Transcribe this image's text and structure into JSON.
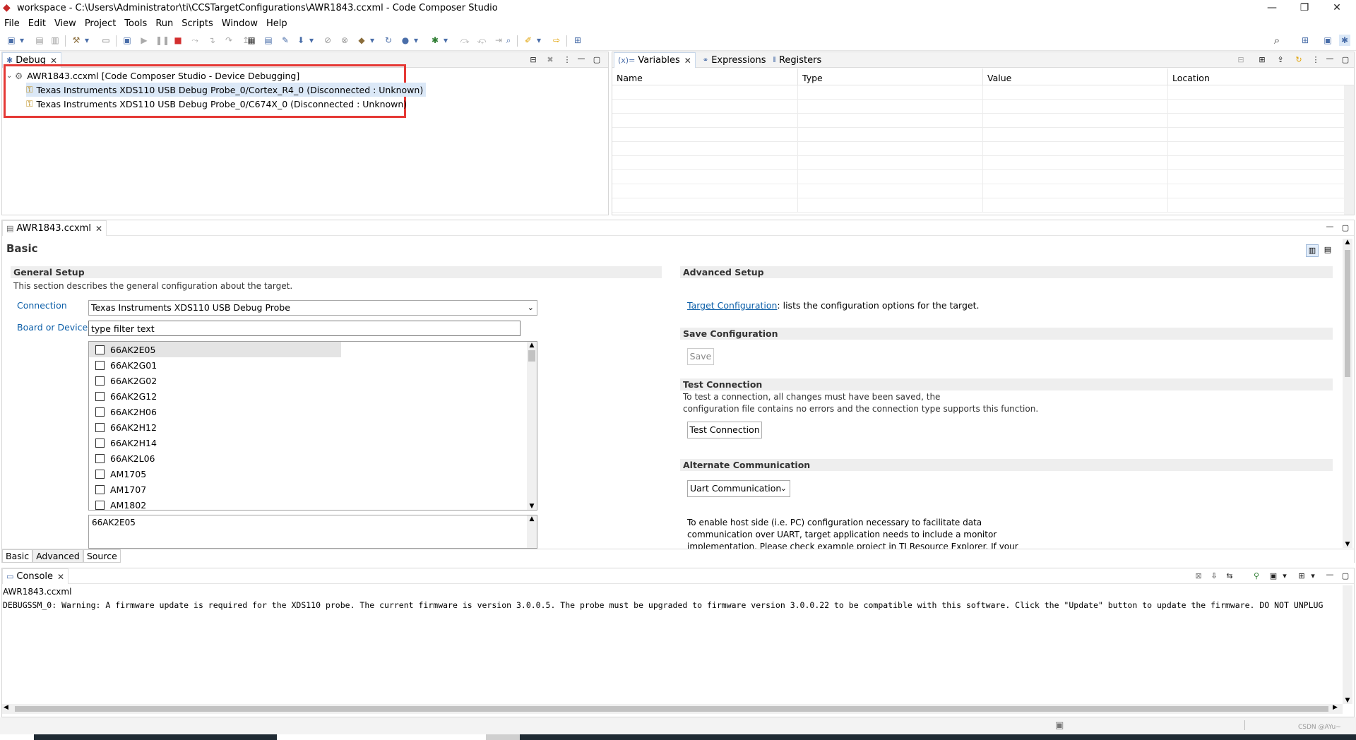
{
  "window": {
    "title": "workspace - C:\\Users\\Administrator\\ti\\CCSTargetConfigurations\\AWR1843.ccxml - Code Composer Studio",
    "minimize": "—",
    "restore": "❐",
    "close": "✕"
  },
  "menu": [
    "File",
    "Edit",
    "View",
    "Project",
    "Tools",
    "Run",
    "Scripts",
    "Window",
    "Help"
  ],
  "debug_view": {
    "tab_label": "Debug",
    "root": "AWR1843.ccxml [Code Composer Studio - Device Debugging]",
    "items": [
      "Texas Instruments XDS110 USB Debug Probe_0/Cortex_R4_0 (Disconnected : Unknown)",
      "Texas Instruments XDS110 USB Debug Probe_0/C674X_0 (Disconnected : Unknown)"
    ]
  },
  "variables_view": {
    "tabs": [
      "Variables",
      "Expressions",
      "Registers"
    ],
    "columns": [
      "Name",
      "Type",
      "Value",
      "Location"
    ]
  },
  "editor": {
    "tab_label": "AWR1843.ccxml",
    "heading": "Basic",
    "general_setup": {
      "title": "General Setup",
      "description": "This section describes the general configuration about the target.",
      "connection_label": "Connection",
      "connection_value": "Texas Instruments XDS110 USB Debug Probe",
      "board_label": "Board or Device",
      "filter_placeholder": "type filter text",
      "devices": [
        "66AK2E05",
        "66AK2G01",
        "66AK2G02",
        "66AK2G12",
        "66AK2H06",
        "66AK2H12",
        "66AK2H14",
        "66AK2L06",
        "AM1705",
        "AM1707",
        "AM1802"
      ],
      "selected_text": "66AK2E05"
    },
    "advanced_setup": {
      "title": "Advanced Setup",
      "link": "Target Configuration",
      "link_suffix": ": lists the configuration options for the target."
    },
    "save_configuration": {
      "title": "Save Configuration",
      "button": "Save"
    },
    "test_connection": {
      "title": "Test Connection",
      "line1": "To test a connection, all changes must have been saved, the",
      "line2": "configuration file contains no errors and the connection type supports this function.",
      "button": "Test Connection"
    },
    "alternate_communication": {
      "title": "Alternate Communication",
      "combo_value": "Uart Communication",
      "line1": "To enable host side (i.e. PC) configuration necessary to facilitate data",
      "line2": "communication over UART, target application needs to include a monitor",
      "line3": "implementation. Please check example project in TI Resource Explorer. If your"
    },
    "bottom_tabs": [
      "Basic",
      "Advanced",
      "Source"
    ]
  },
  "console": {
    "tab_label": "Console",
    "source": "AWR1843.ccxml",
    "message": "DEBUGSSM_0: Warning: A firmware update is required for the XDS110 probe. The current firmware is version 3.0.0.5. The probe must be upgraded to firmware version 3.0.0.22 to be compatible with this software. Click the \"Update\" button to update the firmware. DO NOT UNPLUG"
  },
  "watermark": "CSDN @AYu~"
}
